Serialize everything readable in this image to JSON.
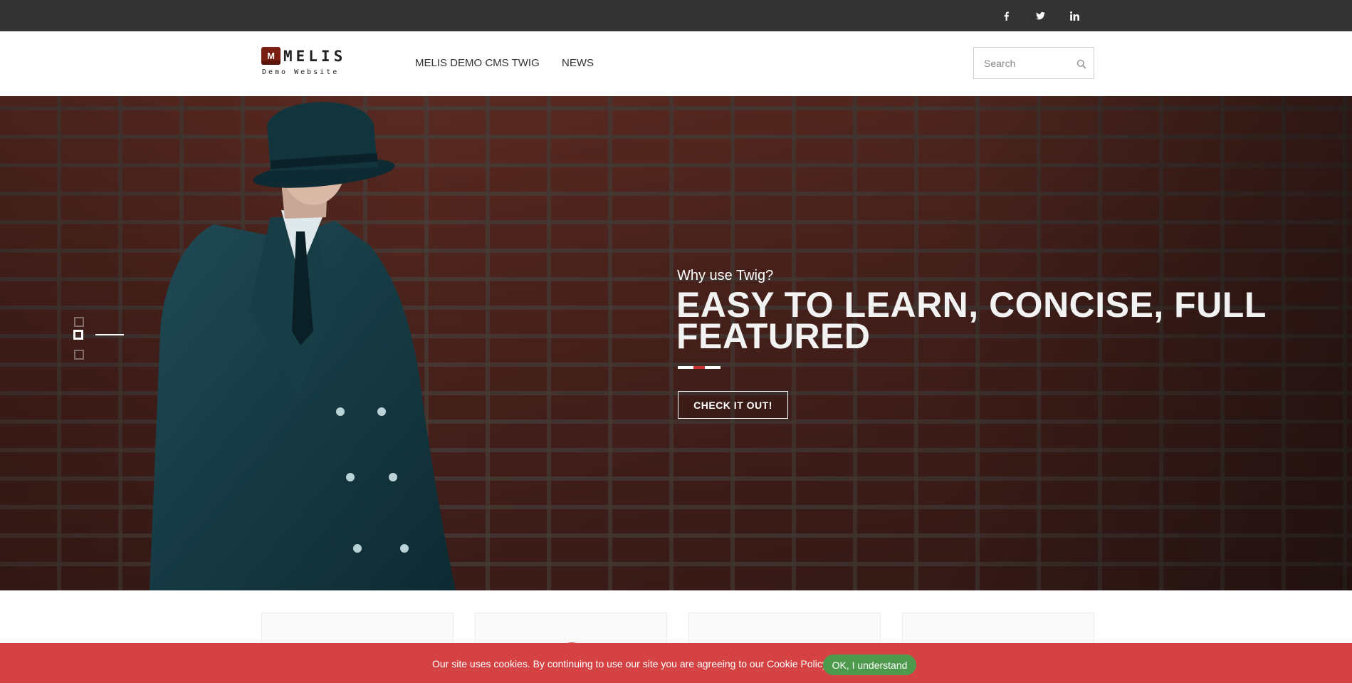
{
  "topbar": {
    "social": [
      {
        "name": "facebook-icon",
        "glyph": "f"
      },
      {
        "name": "twitter-icon",
        "glyph": "t"
      },
      {
        "name": "linkedin-icon",
        "glyph": "in"
      }
    ]
  },
  "header": {
    "logo_mark": "M",
    "logo_word": "MELIS",
    "logo_sub": "Demo Website",
    "nav": [
      "MELIS DEMO CMS TWIG",
      "NEWS"
    ],
    "search_placeholder": "Search"
  },
  "hero": {
    "subtitle": "Why use Twig?",
    "title": "EASY TO LEARN, CONCISE, FULL FEATURED",
    "button": "CHECK IT OUT!",
    "slides_count": 3,
    "active_slide": 2
  },
  "cookie": {
    "text": "Our site uses cookies. By continuing to use our site you are agreeing to our Cookie Policy.",
    "button": "OK, I understand"
  },
  "colors": {
    "topbar": "#333333",
    "accent_red": "#d54243",
    "cookie_button": "#4e9a4d",
    "logo": "#7a1f12"
  }
}
